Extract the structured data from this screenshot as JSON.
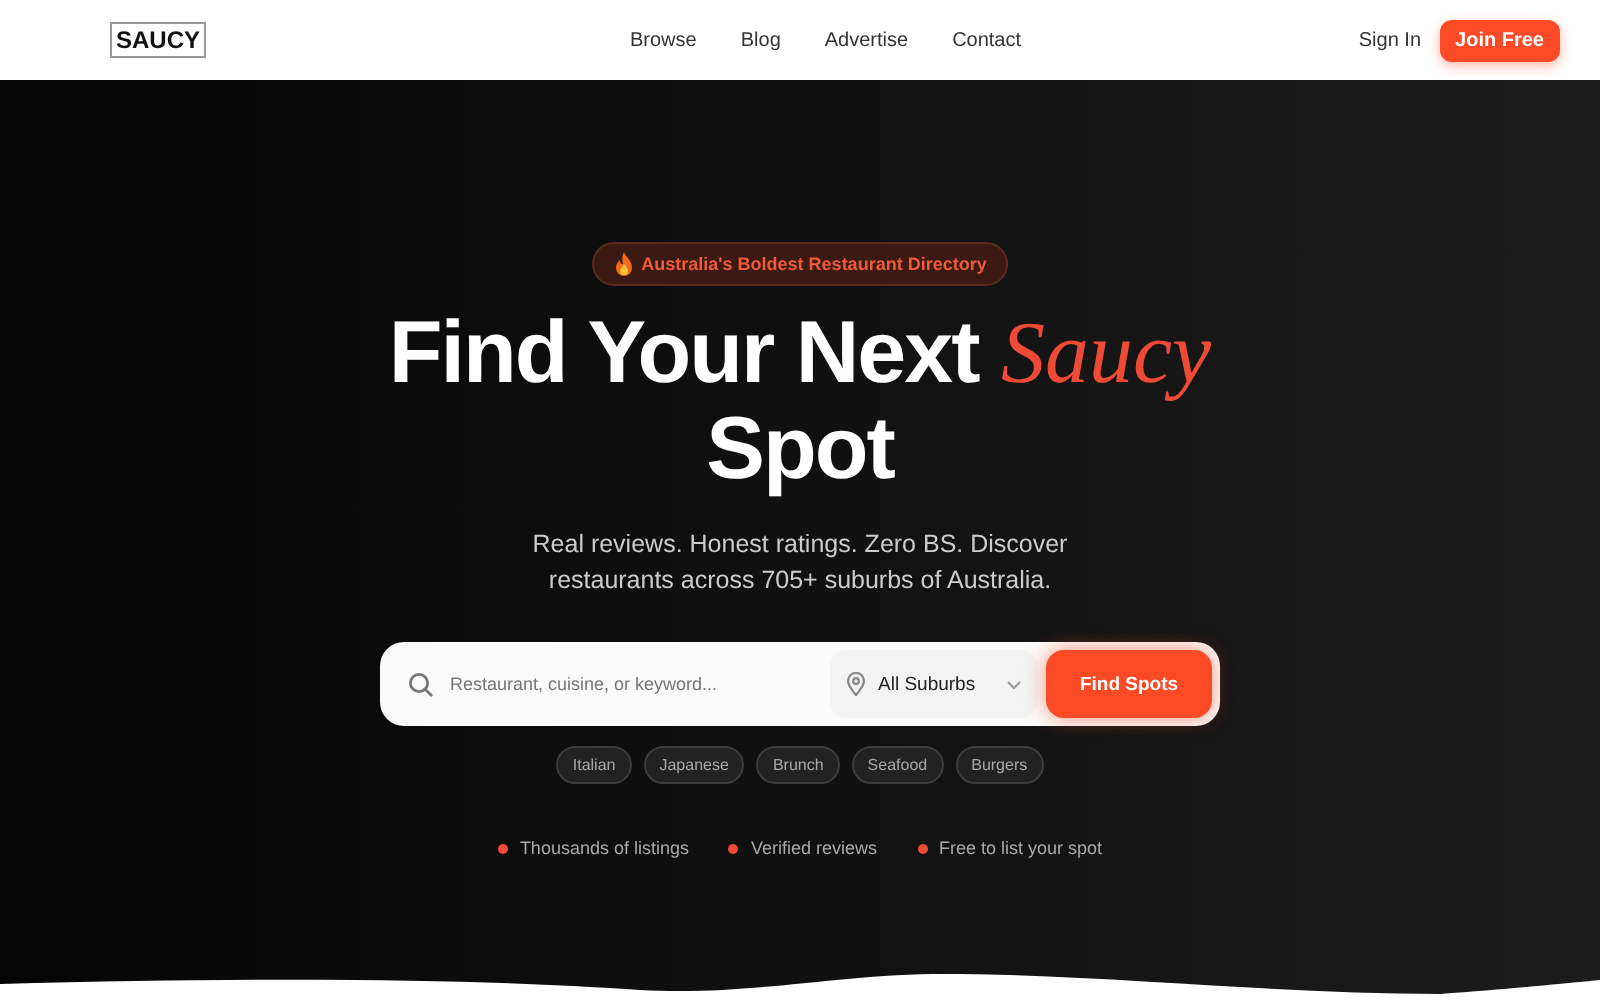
{
  "nav": {
    "logo": "SAUCY",
    "links": [
      "Browse",
      "Blog",
      "Advertise",
      "Contact"
    ],
    "sign_in": "Sign In",
    "join": "Join Free"
  },
  "hero": {
    "badge": "Australia's Boldest Restaurant Directory",
    "title_line_1": "Find Your Next",
    "title_accent": "Saucy",
    "title_line_2": "Spot",
    "subtitle": "Real reviews. Honest ratings. Zero BS. Discover restaurants across 705+ suburbs of Australia.",
    "search": {
      "placeholder": "Restaurant, cuisine, or keyword...",
      "location": "All Suburbs",
      "button": "Find Spots"
    },
    "tags": [
      "Italian",
      "Japanese",
      "Brunch",
      "Seafood",
      "Burgers"
    ],
    "features": [
      {
        "label": "Thousands of listings",
        "color": "#ef4a36"
      },
      {
        "label": "Verified reviews",
        "color": "#ef4a36"
      },
      {
        "label": "Free to list your spot",
        "color": "#ef4a36"
      }
    ]
  }
}
